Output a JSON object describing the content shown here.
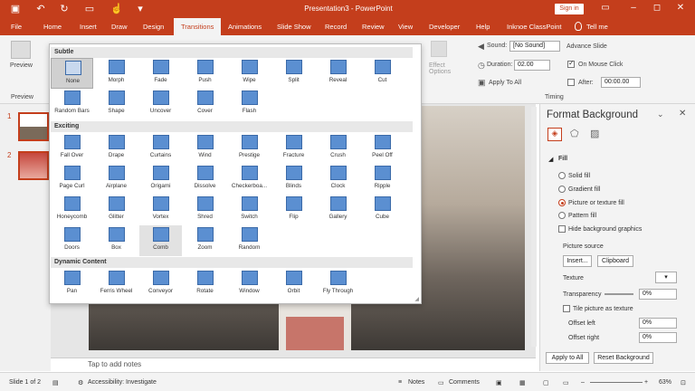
{
  "window": {
    "title": "Presentation3 - PowerPoint",
    "signin": "Sign in",
    "tellme": "Tell me"
  },
  "tabs": [
    "File",
    "Home",
    "Insert",
    "Draw",
    "Design",
    "Transitions",
    "Animations",
    "Slide Show",
    "Record",
    "Review",
    "View",
    "Developer",
    "Help",
    "Inknoe ClassPoint"
  ],
  "ribbon": {
    "preview": "Preview",
    "preview_group": "Preview",
    "effect_options": "Effect Options",
    "sound_label": "Sound:",
    "sound_value": "[No Sound]",
    "duration_label": "Duration:",
    "duration_value": "02.00",
    "apply_all": "Apply To All",
    "advance": "Advance Slide",
    "on_click": "On Mouse Click",
    "after": "After:",
    "after_value": "00:00.00",
    "timing": "Timing"
  },
  "slides": {
    "n1": "1",
    "n2": "2"
  },
  "gallery": {
    "subtle": "Subtle",
    "exciting": "Exciting",
    "dynamic": "Dynamic Content",
    "subtle_items": [
      "None",
      "Morph",
      "Fade",
      "Push",
      "Wipe",
      "Split",
      "Reveal",
      "Cut",
      "Random Bars",
      "Shape",
      "Uncover",
      "Cover",
      "Flash"
    ],
    "exciting_items": [
      "Fall Over",
      "Drape",
      "Curtains",
      "Wind",
      "Prestige",
      "Fracture",
      "Crush",
      "Peel Off",
      "Page Curl",
      "Airplane",
      "Origami",
      "Dissolve",
      "Checkerboa...",
      "Blinds",
      "Clock",
      "Ripple",
      "Honeycomb",
      "Glitter",
      "Vortex",
      "Shred",
      "Switch",
      "Flip",
      "Gallery",
      "Cube",
      "Doors",
      "Box",
      "Comb",
      "Zoom",
      "Random"
    ],
    "dynamic_items": [
      "Pan",
      "Ferris Wheel",
      "Conveyor",
      "Rotate",
      "Window",
      "Orbit",
      "Fly Through"
    ]
  },
  "format_bg": {
    "title": "Format Background",
    "fill": "Fill",
    "solid": "Solid fill",
    "gradient": "Gradient fill",
    "picture": "Picture or texture fill",
    "pattern": "Pattern fill",
    "hide": "Hide background graphics",
    "source": "Picture source",
    "insert": "Insert...",
    "clipboard": "Clipboard",
    "texture": "Texture",
    "transparency": "Transparency",
    "transparency_value": "0%",
    "tile": "Tile picture as texture",
    "offset_left": "Offset left",
    "offset_left_value": "0%",
    "offset_right": "Offset right",
    "offset_right_value": "0%",
    "apply_all": "Apply to All",
    "reset": "Reset Background"
  },
  "notes": "Tap to add notes",
  "status": {
    "slide": "Slide 1 of 2",
    "accessibility": "Accessibility: Investigate",
    "notes": "Notes",
    "comments": "Comments",
    "zoom": "63%"
  }
}
